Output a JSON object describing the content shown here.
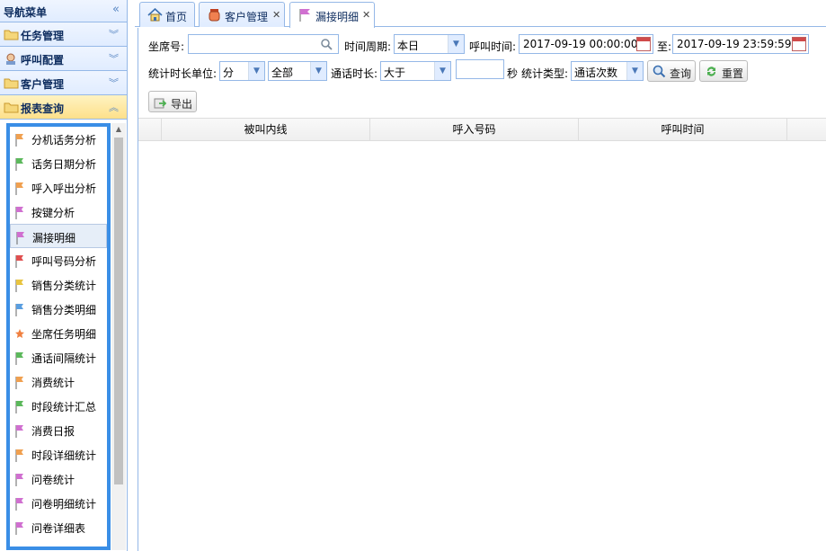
{
  "nav": {
    "title": "导航菜单"
  },
  "sections": [
    {
      "label": "任务管理"
    },
    {
      "label": "呼叫配置"
    },
    {
      "label": "客户管理"
    },
    {
      "label": "报表查询"
    }
  ],
  "menu": {
    "items": [
      {
        "label": "分机话务分析"
      },
      {
        "label": "话务日期分析"
      },
      {
        "label": "呼入呼出分析"
      },
      {
        "label": "按键分析"
      },
      {
        "label": "漏接明细"
      },
      {
        "label": "呼叫号码分析"
      },
      {
        "label": "销售分类统计"
      },
      {
        "label": "销售分类明细"
      },
      {
        "label": "坐席任务明细"
      },
      {
        "label": "通话间隔统计"
      },
      {
        "label": "消费统计"
      },
      {
        "label": "时段统计汇总"
      },
      {
        "label": "消费日报"
      },
      {
        "label": "时段详细统计"
      },
      {
        "label": "问卷统计"
      },
      {
        "label": "问卷明细统计"
      },
      {
        "label": "问卷详细表"
      }
    ],
    "selected": "漏接明细"
  },
  "tabs": [
    {
      "label": "首页"
    },
    {
      "label": "客户管理"
    },
    {
      "label": "漏接明细"
    }
  ],
  "filters": {
    "agent_label": "坐席号:",
    "agent_value": "",
    "period_label": "时间周期:",
    "period_value": "本日",
    "calltime_label": "呼叫时间:",
    "start_time": "2017-09-19 00:00:00",
    "to_label": "至:",
    "end_time": "2017-09-19 23:59:59",
    "duration_unit_label": "统计时长单位:",
    "duration_unit_value": "分",
    "scope_value": "全部",
    "talk_label": "通话时长:",
    "compare_value": "大于",
    "seconds_value": "",
    "seconds_label": "秒",
    "stat_type_label": "统计类型:",
    "stat_type_value": "通话次数",
    "query_label": "查询",
    "reset_label": "重置",
    "export_label": "导出"
  },
  "grid": {
    "columns": [
      "被叫内线",
      "呼入号码",
      "呼叫时间"
    ]
  }
}
